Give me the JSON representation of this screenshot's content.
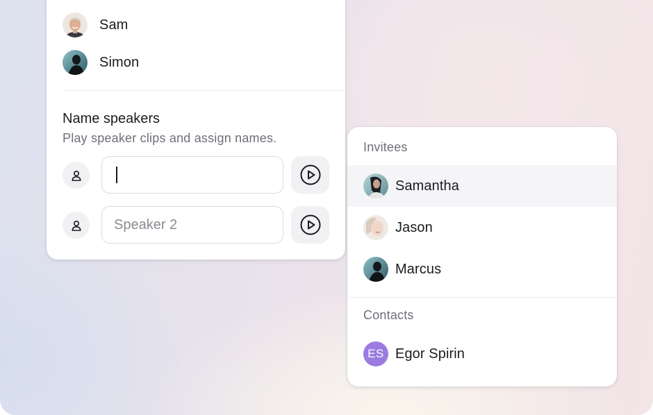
{
  "participants": [
    {
      "name": "Sam",
      "avatar": "avatar-photo-older-man"
    },
    {
      "name": "Simon",
      "avatar": "avatar-photo-dark-silhouette"
    }
  ],
  "name_speakers": {
    "title": "Name speakers",
    "subtitle": "Play speaker clips and assign names.",
    "speakers": [
      {
        "value": "",
        "placeholder": "",
        "focused": true,
        "icon": "user-icon",
        "play_icon": "play-circle-icon"
      },
      {
        "value": "",
        "placeholder": "Speaker 2",
        "focused": false,
        "icon": "user-icon",
        "play_icon": "play-circle-icon"
      }
    ]
  },
  "dropdown": {
    "invitees_heading": "Invitees",
    "invitees": [
      {
        "name": "Samantha",
        "highlighted": true
      },
      {
        "name": "Jason",
        "highlighted": false
      },
      {
        "name": "Marcus",
        "highlighted": false
      }
    ],
    "contacts_heading": "Contacts",
    "contacts": [
      {
        "name": "Egor Spirin",
        "initials": "ES",
        "avatar_color": "#9b7be0"
      }
    ]
  }
}
